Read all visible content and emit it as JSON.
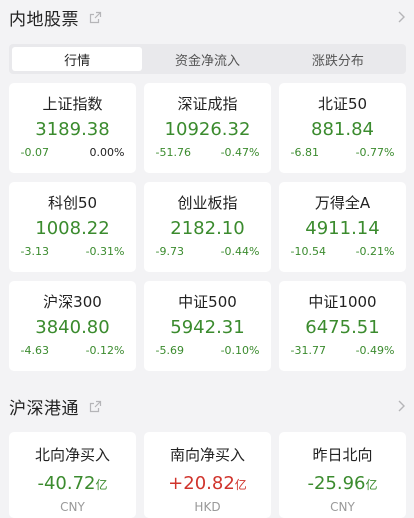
{
  "section1": {
    "title": "内地股票"
  },
  "tabs": [
    {
      "label": "行情",
      "active": true
    },
    {
      "label": "资金净流入",
      "active": false
    },
    {
      "label": "涨跌分布",
      "active": false
    }
  ],
  "indices": [
    {
      "name": "上证指数",
      "value": "3189.38",
      "change": "-0.07",
      "pct": "0.00%"
    },
    {
      "name": "深证成指",
      "value": "10926.32",
      "change": "-51.76",
      "pct": "-0.47%"
    },
    {
      "name": "北证50",
      "value": "881.84",
      "change": "-6.81",
      "pct": "-0.77%"
    },
    {
      "name": "科创50",
      "value": "1008.22",
      "change": "-3.13",
      "pct": "-0.31%"
    },
    {
      "name": "创业板指",
      "value": "2182.10",
      "change": "-9.73",
      "pct": "-0.44%"
    },
    {
      "name": "万得全A",
      "value": "4911.14",
      "change": "-10.54",
      "pct": "-0.21%"
    },
    {
      "name": "沪深300",
      "value": "3840.80",
      "change": "-4.63",
      "pct": "-0.12%"
    },
    {
      "name": "中证500",
      "value": "5942.31",
      "change": "-5.69",
      "pct": "-0.10%"
    },
    {
      "name": "中证1000",
      "value": "6475.51",
      "change": "-31.77",
      "pct": "-0.49%"
    }
  ],
  "section2": {
    "title": "沪深港通"
  },
  "flows": [
    {
      "label": "北向净买入",
      "value": "-40.72",
      "unit": "亿",
      "currency": "CNY",
      "direction": "neg"
    },
    {
      "label": "南向净买入",
      "value": "+20.82",
      "unit": "亿",
      "currency": "HKD",
      "direction": "pos"
    },
    {
      "label": "昨日北向",
      "value": "-25.96",
      "unit": "亿",
      "currency": "CNY",
      "direction": "neg"
    }
  ],
  "colors": {
    "down": "#3b8b2e",
    "up": "#d0342c",
    "flat": "#222222",
    "muted": "#999999"
  },
  "icons": {
    "title_icon": "external-link-icon",
    "nav_icon": "chevron-right-icon"
  }
}
